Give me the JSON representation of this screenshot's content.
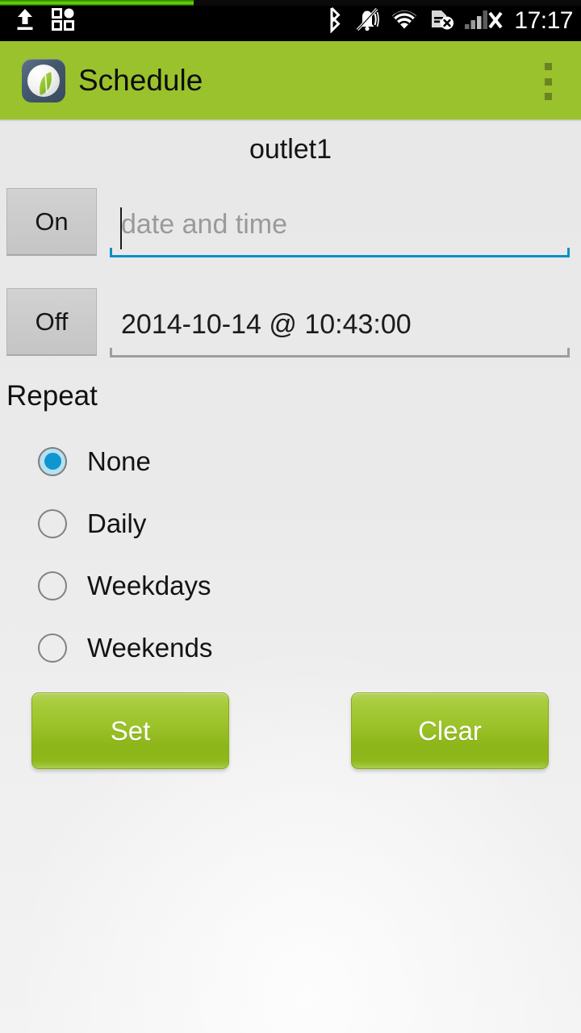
{
  "status_bar": {
    "left_icons": [
      "upload-icon",
      "apps-grid-icon"
    ],
    "right_icons": [
      "bluetooth-icon",
      "vibrate-mute-icon",
      "wifi-icon",
      "sim-card-error-icon",
      "signal-bars-no-service-icon"
    ],
    "clock": "17:17"
  },
  "progress": {
    "percent": 33
  },
  "action_bar": {
    "app_icon": "leaf-app-icon",
    "title": "Schedule",
    "overflow": "overflow-menu-icon",
    "background_color": "#9ac22d"
  },
  "main": {
    "outlet_title": "outlet1",
    "rows": [
      {
        "state_label": "On",
        "value": "",
        "placeholder": "date and time",
        "focused": true,
        "underline_color": "#0e8fc6"
      },
      {
        "state_label": "Off",
        "value": "2014-10-14 @ 10:43:00",
        "placeholder": "date and time",
        "focused": false,
        "underline_color": "#9d9d9d"
      }
    ],
    "repeat": {
      "label": "Repeat",
      "selected": "None",
      "options": [
        {
          "label": "None",
          "checked": true
        },
        {
          "label": "Daily",
          "checked": false
        },
        {
          "label": "Weekdays",
          "checked": false
        },
        {
          "label": "Weekends",
          "checked": false
        }
      ],
      "accent_color": "#0f96cf"
    },
    "buttons": {
      "set": "Set",
      "clear": "Clear",
      "color": "#9cc32a"
    }
  }
}
